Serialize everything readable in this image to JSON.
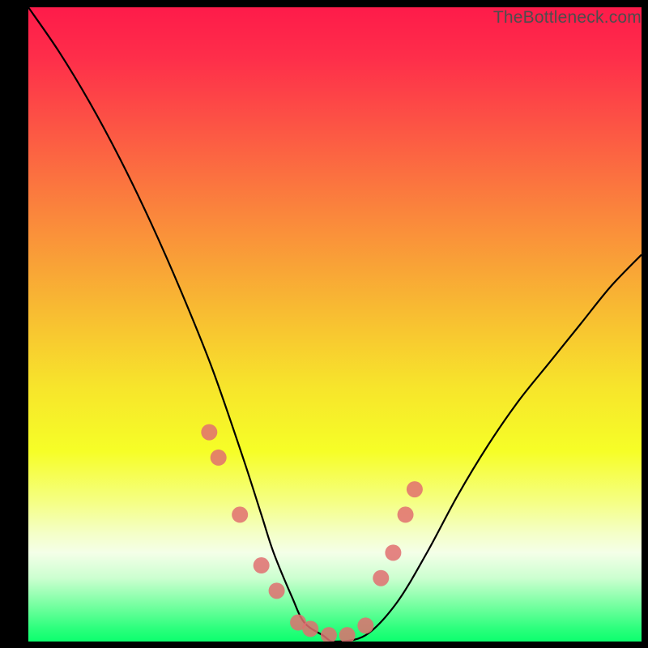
{
  "watermark": "TheBottleneck.com",
  "colors": {
    "background": "#000000",
    "gradient_top": "#fe1b4a",
    "gradient_bottom": "#0cff6e",
    "curve_stroke": "#000000",
    "marker_fill": "#e06f70",
    "marker_stroke": "#c25a5b"
  },
  "chart_data": {
    "type": "line",
    "title": "",
    "xlabel": "",
    "ylabel": "",
    "xlim": [
      0,
      100
    ],
    "ylim": [
      0,
      100
    ],
    "series": [
      {
        "name": "bottleneck-curve",
        "x": [
          0,
          5,
          10,
          15,
          20,
          25,
          30,
          35,
          38,
          40,
          43,
          45,
          48,
          50,
          55,
          60,
          65,
          70,
          75,
          80,
          85,
          90,
          95,
          100
        ],
        "y": [
          100,
          93,
          85,
          76,
          66,
          55,
          43,
          29,
          20,
          14,
          7,
          3,
          1,
          0,
          1,
          6,
          14,
          23,
          31,
          38,
          44,
          50,
          56,
          61
        ]
      }
    ],
    "markers": {
      "name": "sample-points",
      "x": [
        29.5,
        31.0,
        34.5,
        38.0,
        40.5,
        44.0,
        46.0,
        49.0,
        52.0,
        55.0,
        57.5,
        59.5,
        61.5,
        63.0
      ],
      "y": [
        33.0,
        29.0,
        20.0,
        12.0,
        8.0,
        3.0,
        2.0,
        1.0,
        1.0,
        2.5,
        10.0,
        14.0,
        20.0,
        24.0
      ]
    }
  }
}
